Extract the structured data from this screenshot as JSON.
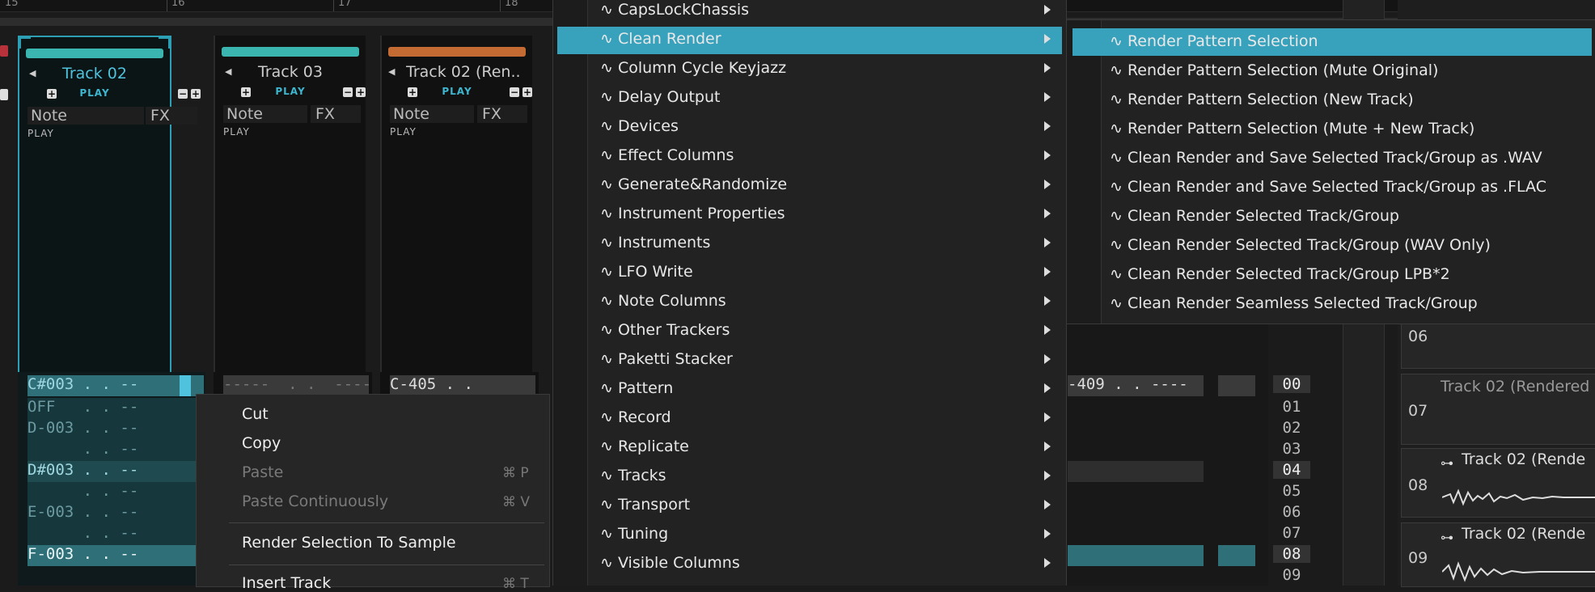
{
  "ruler": {
    "labels": [
      "15",
      "16",
      "17",
      "18"
    ]
  },
  "tracks": [
    {
      "name": "Track 02",
      "active": true,
      "color": "#3ab5b0",
      "name_color": "#4fc3dd",
      "note_label": "Note",
      "fx_label": "FX",
      "play_label": "PLAY",
      "sub_label": "PLAY"
    },
    {
      "name": "Track 03",
      "active": false,
      "color": "#3ab5b0",
      "name_color": "#cccccc",
      "note_label": "Note",
      "fx_label": "FX",
      "play_label": "PLAY",
      "sub_label": "PLAY"
    },
    {
      "name": "Track 02 (Ren..",
      "active": false,
      "color": "#c46a33",
      "name_color": "#cccccc",
      "note_label": "Note",
      "fx_label": "FX",
      "play_label": "PLAY",
      "sub_label": "PLAY"
    }
  ],
  "pattern": {
    "track1_rows": [
      "C#003 . . --",
      "OFF   . . --",
      "D-003 . . --",
      "      . . --",
      "D#003 . . --",
      "      . . --",
      "E-003 . . --",
      "      . . --",
      "F-003 . . --"
    ],
    "track2_row0": "-----  . .  ----",
    "track3_row0": "C-405 . .",
    "right_row0": "-409 . . ----",
    "row_numbers": [
      "00",
      "01",
      "02",
      "03",
      "04",
      "05",
      "06",
      "07",
      "08",
      "09"
    ]
  },
  "right_panel": [
    {
      "num": "06",
      "name": ""
    },
    {
      "num": "07",
      "name": "Track 02 (Rendered"
    },
    {
      "num": "08",
      "name": "Track 02 (Rende"
    },
    {
      "num": "09",
      "name": "Track 02 (Rende"
    }
  ],
  "context_menu": {
    "items": [
      {
        "label": "Cut",
        "disabled": false,
        "shortcut": ""
      },
      {
        "label": "Copy",
        "disabled": false,
        "shortcut": ""
      },
      {
        "label": "Paste",
        "disabled": true,
        "shortcut": "⌘ P"
      },
      {
        "label": "Paste Continuously",
        "disabled": true,
        "shortcut": "⌘ V"
      },
      {
        "label": "Render Selection To Sample",
        "disabled": false,
        "shortcut": ""
      },
      {
        "label": "Insert Track",
        "disabled": false,
        "shortcut": "⌘ T"
      }
    ]
  },
  "main_menu": {
    "items": [
      "∿ CapsLockChassis",
      "∿ Clean Render",
      "∿ Column Cycle Keyjazz",
      "∿ Delay Output",
      "∿ Devices",
      "∿ Effect Columns",
      "∿ Generate&Randomize",
      "∿ Instrument Properties",
      "∿ Instruments",
      "∿ LFO Write",
      "∿ Note Columns",
      "∿ Other Trackers",
      "∿ Paketti Stacker",
      "∿ Pattern",
      "∿ Record",
      "∿ Replicate",
      "∿ Tracks",
      "∿ Transport",
      "∿ Tuning",
      "∿ Visible Columns"
    ],
    "selected_index": 1
  },
  "sub_menu": {
    "items": [
      "∿ Render Pattern Selection",
      "∿ Render Pattern Selection (Mute Original)",
      "∿ Render Pattern Selection (New Track)",
      "∿ Render Pattern Selection (Mute + New Track)",
      "∿ Clean Render and Save Selected Track/Group as .WAV",
      "∿ Clean Render and Save Selected Track/Group as .FLAC",
      "∿ Clean Render Selected Track/Group",
      "∿ Clean Render Selected Track/Group (WAV Only)",
      "∿ Clean Render Selected Track/Group LPB*2",
      "∿ Clean Render Seamless Selected Track/Group"
    ],
    "selected_index": 0
  },
  "colors": {
    "accent": "#38a2bd",
    "track_teal": "#3ab5b0",
    "track_orange": "#c46a33"
  }
}
